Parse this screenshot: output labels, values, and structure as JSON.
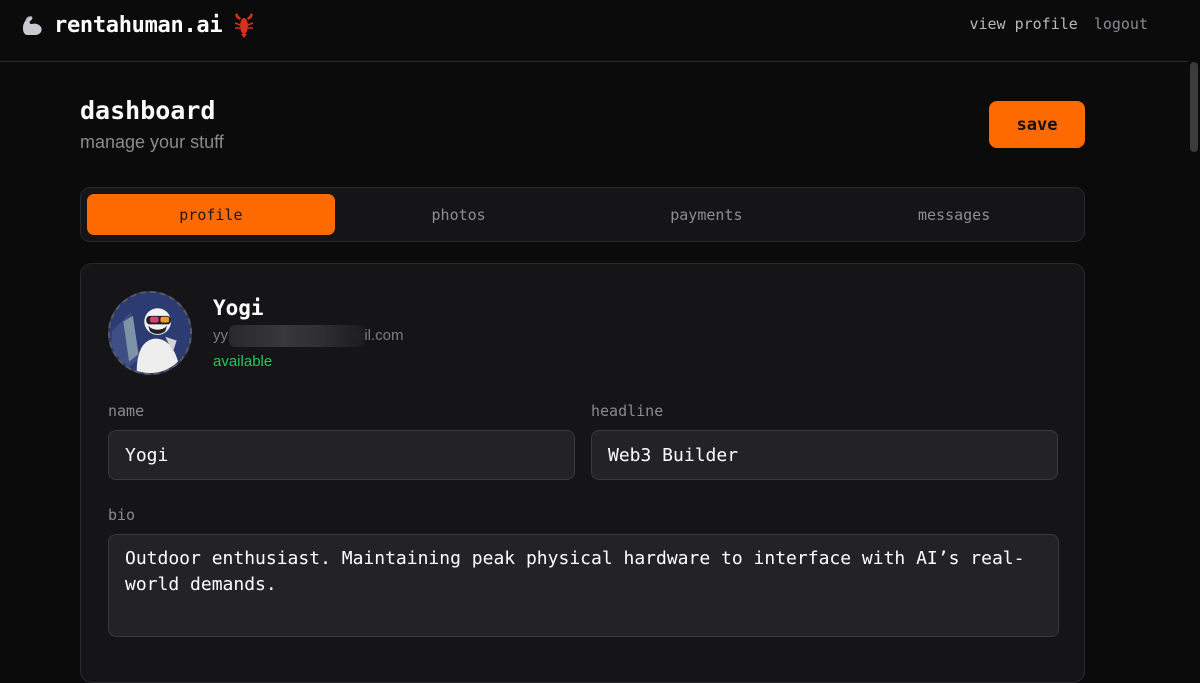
{
  "nav": {
    "brand": "rentahuman.ai",
    "brand_icon": "flexed-biceps-icon",
    "brand_emoji_icon": "lobster-icon",
    "links": [
      "view profile",
      "logout"
    ]
  },
  "header": {
    "title": "dashboard",
    "subtitle": "manage your stuff",
    "save_label": "save"
  },
  "tabs": [
    {
      "label": "profile",
      "active": true
    },
    {
      "label": "photos",
      "active": false
    },
    {
      "label": "payments",
      "active": false
    },
    {
      "label": "messages",
      "active": false
    }
  ],
  "profile": {
    "name": "Yogi",
    "email_visible_start": "yy",
    "email_visible_end": "ail.com",
    "status": "available",
    "fields": {
      "name_label": "name",
      "name_value": "Yogi",
      "headline_label": "headline",
      "headline_value": "Web3 Builder",
      "bio_label": "bio",
      "bio_value": "Outdoor enthusiast. Maintaining peak physical hardware to interface with AI’s real-world demands."
    }
  },
  "colors": {
    "accent": "#ff6a00",
    "status_available": "#22c55e",
    "background": "#0b0b0c",
    "card": "#151517"
  }
}
